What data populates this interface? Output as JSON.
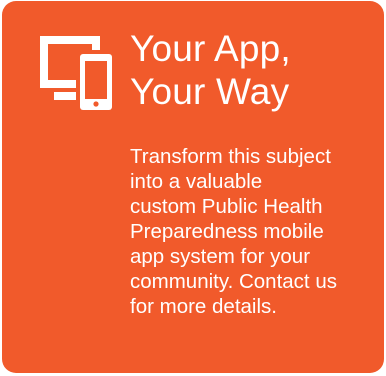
{
  "card": {
    "accent_color": "#f15a2b",
    "text_color": "#ffffff",
    "icon": "devices-icon",
    "title_lines": [
      "Your App,",
      "Your Way"
    ],
    "description_lines": [
      "Transform this subject",
      "into a valuable",
      "custom Public Health",
      "Preparedness mobile",
      "app system for your",
      "community. Contact us",
      "for more details."
    ]
  }
}
